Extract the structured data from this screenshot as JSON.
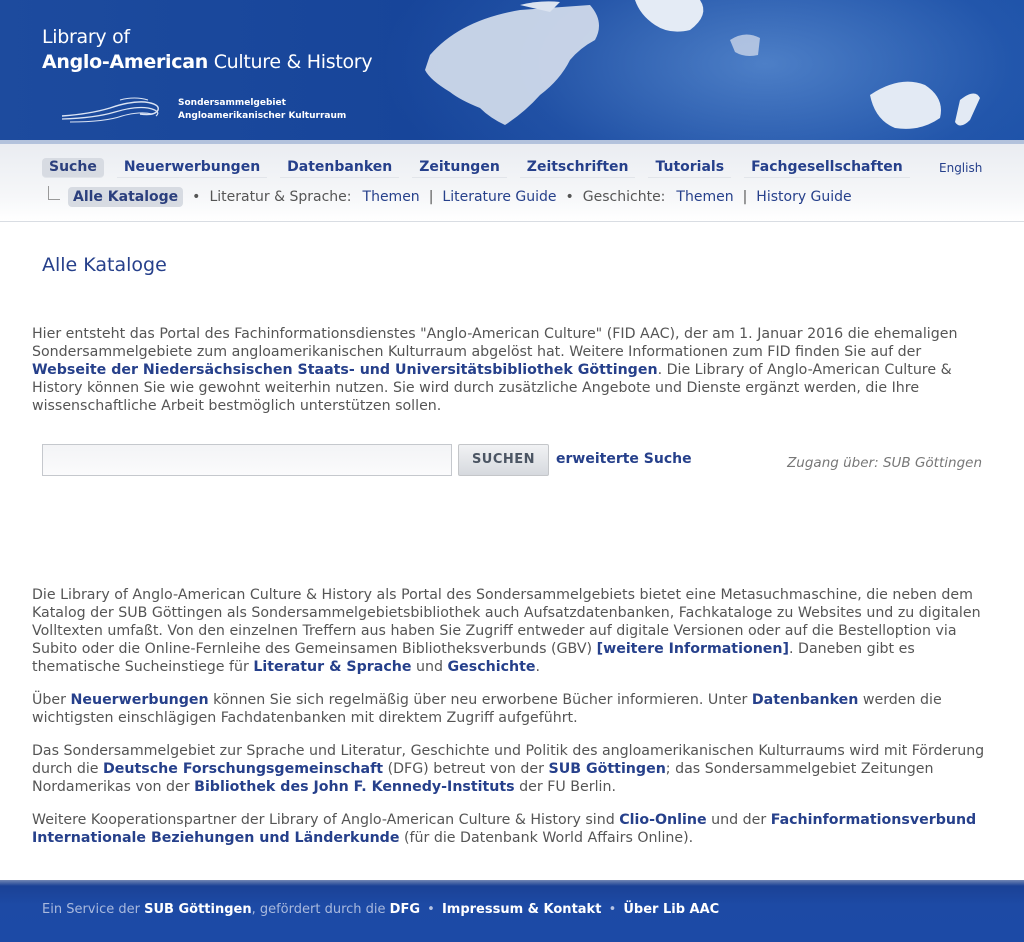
{
  "header": {
    "logo_line1": "Library of",
    "logo_line2_bold": "Anglo-American",
    "logo_line2_rest": " Culture & History",
    "logo_sub1": "Sondersammelgebiet",
    "logo_sub2": "Angloamerikanischer Kulturraum"
  },
  "nav": {
    "items": [
      "Suche",
      "Neuerwerbungen",
      "Datenbanken",
      "Zeitungen",
      "Zeitschriften",
      "Tutorials",
      "Fachgesellschaften"
    ],
    "language": "English"
  },
  "subnav": {
    "active": "Alle Kataloge",
    "bullet": "•",
    "pipe": "|",
    "lit_label": "Literatur & Sprache:",
    "lit_themen": "Themen",
    "lit_guide": "Literature Guide",
    "hist_label": "Geschichte:",
    "hist_themen": "Themen",
    "hist_guide": "History Guide"
  },
  "main": {
    "title": "Alle Kataloge",
    "intro_1": "Hier entsteht das Portal des Fachinformationsdienstes \"Anglo-American Culture\" (FID AAC), der am 1. Januar 2016 die ehemaligen Sondersammelgebiete zum angloamerikanischen Kulturraum abgelöst hat. Weitere Informationen zum FID finden Sie auf der ",
    "intro_link": "Webseite der Niedersächsischen Staats- und Universitätsbibliothek Göttingen",
    "intro_2": ". Die Library of Anglo-American Culture & History können Sie wie gewohnt weiterhin nutzen. Sie wird durch zusätzliche Angebote und Dienste ergänzt werden, die Ihre wissenschaftliche Arbeit bestmöglich unterstützen sollen."
  },
  "search": {
    "value": "",
    "button": "SUCHEN",
    "advanced": "erweiterte Suche",
    "access": "Zugang über: SUB Göttingen"
  },
  "paragraphs": {
    "p1_a": "Die Library of Anglo-American Culture & History als Portal des Sondersammelgebiets bietet eine Metasuchmaschine, die neben dem Katalog der SUB Göttingen als Sondersammelgebietsbibliothek auch Aufsatzdatenbanken, Fachkataloge zu Websites und zu digitalen Volltexten umfaßt. Von den einzelnen Treffern aus haben Sie Zugriff entweder auf digitale Versionen oder auf die Bestelloption via Subito oder die Online-Fernleihe des Gemeinsamen Bibliotheksverbunds (GBV) ",
    "p1_link": "[weitere Informationen]",
    "p1_b": ". Daneben gibt es thematische Sucheinstiege für ",
    "p1_lit": "Literatur & Sprache",
    "p1_und": " und ",
    "p1_gesch": "Geschichte",
    "p1_end": ".",
    "p2_a": "Über ",
    "p2_neu": "Neuerwerbungen",
    "p2_b": " können Sie sich regelmäßig über neu erworbene Bücher informieren. Unter ",
    "p2_db": "Datenbanken",
    "p2_c": " werden die wichtigsten einschlägigen Fachdatenbanken mit direktem Zugriff aufgeführt.",
    "p3_a": "Das Sondersammelgebiet zur Sprache und Literatur, Geschichte und Politik des angloamerikanischen Kulturraums wird mit Förderung durch die ",
    "p3_dfg": "Deutsche Forschungsgemeinschaft",
    "p3_b": " (DFG) betreut von der ",
    "p3_sub": "SUB Göttingen",
    "p3_c": "; das Sondersammelgebiet Zeitungen Nordamerikas von der ",
    "p3_jfk": "Bibliothek des John F. Kennedy-Instituts",
    "p3_d": " der FU Berlin.",
    "p4_a": "Weitere Kooperationspartner der Library of Anglo-American Culture & History sind ",
    "p4_clio": "Clio-Online",
    "p4_b": " und der ",
    "p4_fiv": "Fachinformationsverbund Internationale Beziehungen und Länderkunde",
    "p4_c": " (für die Datenbank World Affairs Online)."
  },
  "footer": {
    "a": "Ein Service der ",
    "sub": "SUB Göttingen",
    "b": ", gefördert durch die ",
    "dfg": "DFG",
    "dot": "•",
    "impressum": "Impressum & Kontakt",
    "ueber": "Über Lib AAC"
  },
  "colors": {
    "brand_blue": "#1d4b9e",
    "link_blue": "#26408b",
    "text_grey": "#555555"
  }
}
